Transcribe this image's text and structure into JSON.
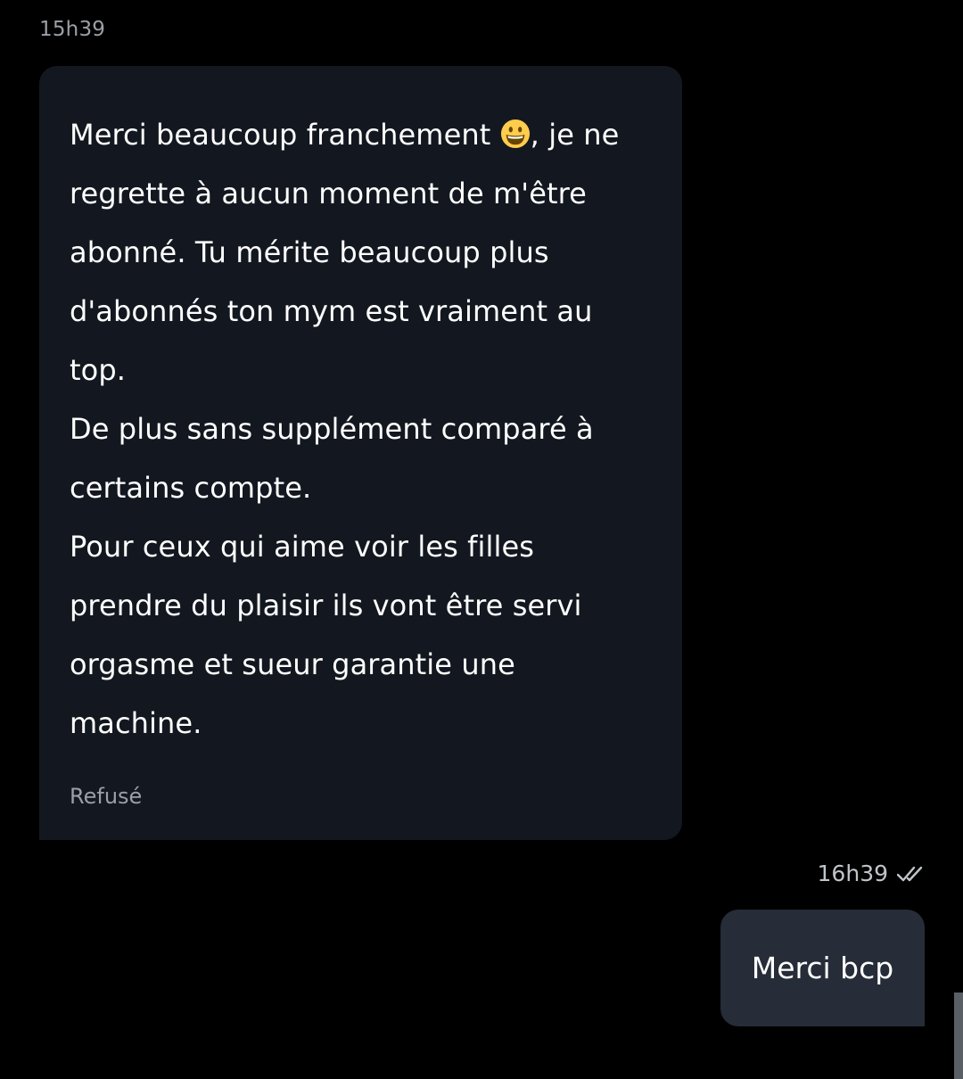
{
  "incoming_message": {
    "time": "15h39",
    "text_before_emoji": "Merci beaucoup franchement ",
    "emoji": "smiling-face-icon",
    "text_after_emoji": ", je ne regrette à aucun moment de m'être abonné. Tu mérite beaucoup plus d'abonnés ton mym est vraiment au top.\nDe plus sans supplément comparé à certains compte.\nPour ceux qui aime voir les filles prendre du plaisir ils vont être servi orgasme et sueur garantie une machine.",
    "status": "Refusé"
  },
  "outgoing_message": {
    "time": "16h39",
    "read_icon": "double-check-icon",
    "text": "Merci bcp"
  },
  "colors": {
    "background": "#000000",
    "incoming_bubble": "#131820",
    "outgoing_bubble": "#262c38",
    "muted_text": "#9aa0a6"
  }
}
